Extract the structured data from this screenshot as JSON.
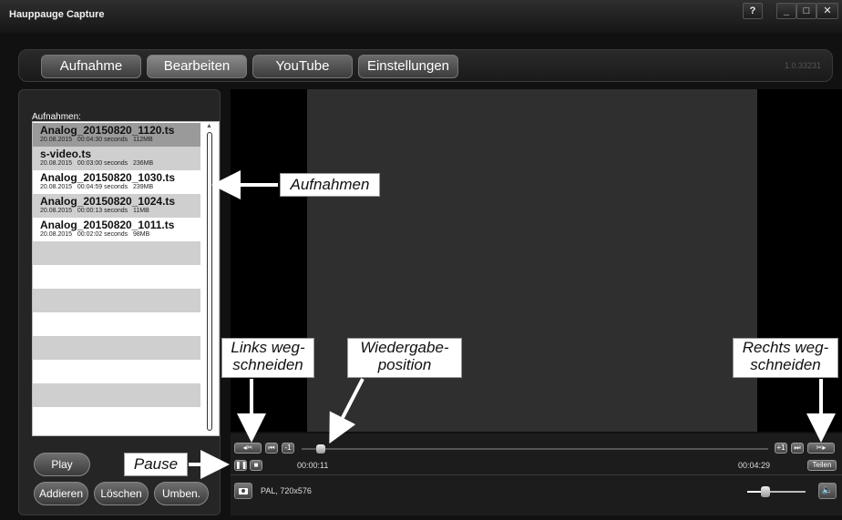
{
  "window": {
    "title": "Hauppauge Capture",
    "help_label": "?",
    "minimize_label": "_",
    "maximize_label": "□",
    "close_label": "✕"
  },
  "tabs": [
    {
      "label": "Aufnahme",
      "active": false
    },
    {
      "label": "Bearbeiten",
      "active": true
    },
    {
      "label": "YouTube",
      "active": false
    },
    {
      "label": "Einstellungen",
      "active": false
    }
  ],
  "version": "1.0.33231",
  "recordings": {
    "title": "Aufnahmen:",
    "items": [
      {
        "name": "Analog_20150820_1120.ts",
        "date": "20.08.2015",
        "duration": "00:04:30 seconds",
        "size": "112MB"
      },
      {
        "name": "s-video.ts",
        "date": "20.08.2015",
        "duration": "00:03:00 seconds",
        "size": "236MB"
      },
      {
        "name": "Analog_20150820_1030.ts",
        "date": "20.08.2015",
        "duration": "00:04:59 seconds",
        "size": "239MB"
      },
      {
        "name": "Analog_20150820_1024.ts",
        "date": "20.08.2015",
        "duration": "00:00:13 seconds",
        "size": "11MB"
      },
      {
        "name": "Analog_20150820_1011.ts",
        "date": "20.08.2015",
        "duration": "00:02:02 seconds",
        "size": "98MB"
      }
    ]
  },
  "buttons": {
    "play": "Play",
    "add": "Addieren",
    "delete": "Löschen",
    "rename": "Umben."
  },
  "player": {
    "current_time": "00:00:11",
    "end_time": "00:04:29",
    "split_label": "Teilen",
    "format": "PAL, 720x576",
    "position_fraction": 0.04,
    "volume_fraction": 0.3
  },
  "annotations": {
    "aufnahmen": "Aufnahmen",
    "links_line1": "Links weg-",
    "links_line2": "schneiden",
    "wieder_line1": "Wiedergabe-",
    "wieder_line2": "position",
    "rechts_line1": "Rechts weg-",
    "rechts_line2": "schneiden",
    "pause": "Pause"
  }
}
